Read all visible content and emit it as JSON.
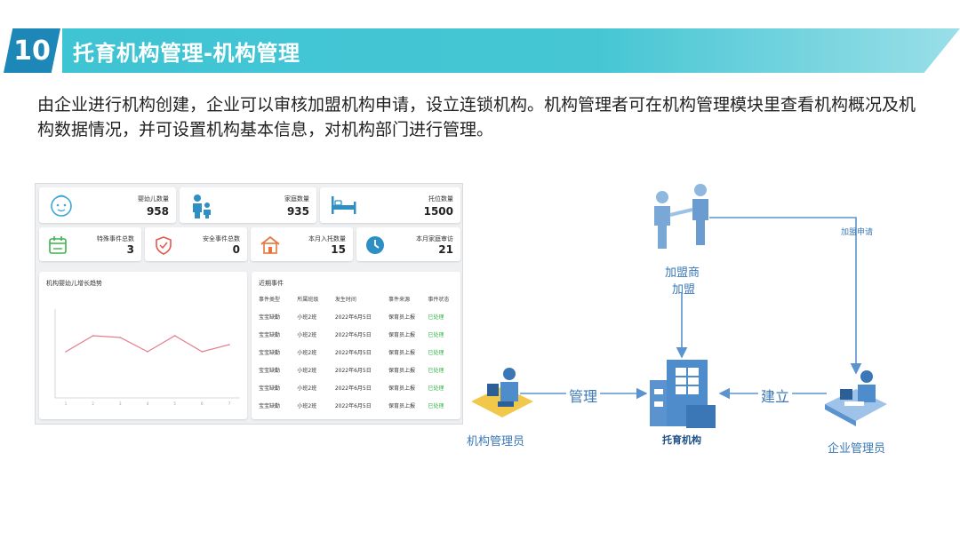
{
  "header": {
    "number": "10",
    "title": "托育机构管理-机构管理"
  },
  "description": "由企业进行机构创建，企业可以审核加盟机构申请，设立连锁机构。机构管理者可在机构管理模块里查看机构概况及机构数据情况，并可设置机构基本信息，对机构部门进行管理。",
  "dashboard": {
    "stats_top": [
      {
        "label": "婴幼儿数量",
        "value": "958",
        "icon": "baby-face-icon"
      },
      {
        "label": "家庭数量",
        "value": "935",
        "icon": "family-icon"
      },
      {
        "label": "托位数量",
        "value": "1500",
        "icon": "bed-icon"
      }
    ],
    "stats_bottom": [
      {
        "label": "特殊事件总数",
        "value": "3",
        "icon": "calendar-icon"
      },
      {
        "label": "安全事件总数",
        "value": "0",
        "icon": "shield-icon"
      },
      {
        "label": "本月入托数量",
        "value": "15",
        "icon": "house-icon"
      },
      {
        "label": "本月家庭审访",
        "value": "21",
        "icon": "clock-icon"
      }
    ],
    "chart_title": "机构婴幼儿增长趋势",
    "chart_data": {
      "type": "line",
      "title": "机构婴幼儿增长趋势",
      "x": [
        "1",
        "2",
        "3",
        "4",
        "5",
        "6",
        "7"
      ],
      "values": [
        26,
        35,
        34,
        26,
        35,
        26,
        30
      ],
      "ylim": [
        0,
        50
      ],
      "grid": false,
      "color": "#e57b8c"
    },
    "events": {
      "title": "近期事件",
      "columns": [
        "事件类型",
        "所属班级",
        "发生时间",
        "事件来源",
        "事件状态"
      ],
      "rows": [
        [
          "宝宝缺勤",
          "小班2班",
          "2022年6月5日",
          "保育员上报",
          "已处理"
        ],
        [
          "宝宝缺勤",
          "小班2班",
          "2022年6月5日",
          "保育员上报",
          "已处理"
        ],
        [
          "宝宝缺勤",
          "小班2班",
          "2022年6月5日",
          "保育员上报",
          "已处理"
        ],
        [
          "宝宝缺勤",
          "小班2班",
          "2022年6月5日",
          "保育员上报",
          "已处理"
        ],
        [
          "宝宝缺勤",
          "小班2班",
          "2022年6月5日",
          "保育员上报",
          "已处理"
        ],
        [
          "宝宝缺勤",
          "小班2班",
          "2022年6月5日",
          "保育员上报",
          "已处理"
        ]
      ]
    }
  },
  "diagram": {
    "franchisee_line1": "加盟商",
    "franchisee_line2": "加盟",
    "apply_label": "加盟申请",
    "manage_label": "管理",
    "establish_label": "建立",
    "org_admin": "机构管理员",
    "institution": "托育机构",
    "enterprise_admin": "企业管理员"
  },
  "colors": {
    "banner": "#46c6d3",
    "banner_number": "#1d87b8",
    "diagram_blue": "#3a78b8",
    "status_ok": "#36b34a"
  }
}
